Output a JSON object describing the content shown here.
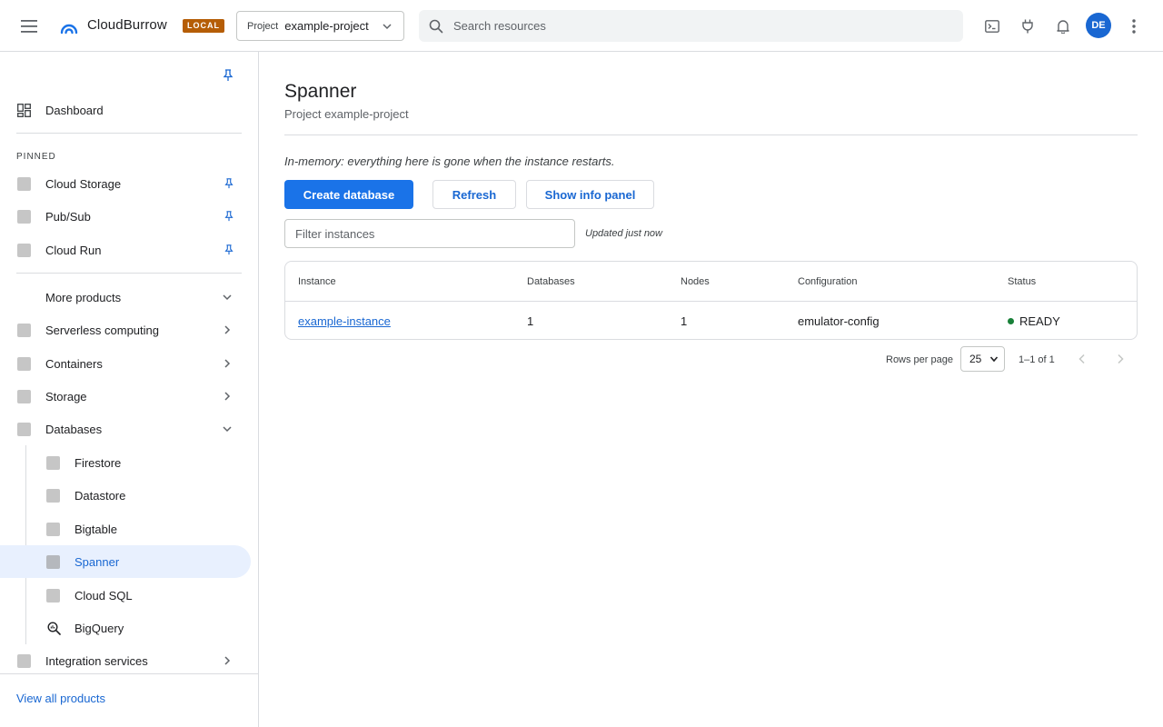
{
  "header": {
    "brand": "CloudBurrow",
    "env_badge": "LOCAL",
    "project_label": "Project",
    "project_value": "example-project",
    "search_placeholder": "Search resources",
    "avatar_initials": "DE",
    "icons": [
      "menu-icon",
      "cloud-logo-icon",
      "chevron-down-icon",
      "search-icon",
      "terminal-icon",
      "plug-icon",
      "bell-icon",
      "more-vert-icon"
    ]
  },
  "sidebar": {
    "dashboard": "Dashboard",
    "pinned_heading": "PINNED",
    "pinned": [
      {
        "label": "Cloud Storage"
      },
      {
        "label": "Pub/Sub"
      },
      {
        "label": "Cloud Run"
      }
    ],
    "more_products": "More products",
    "categories": [
      {
        "label": "Serverless computing"
      },
      {
        "label": "Containers"
      },
      {
        "label": "Storage"
      },
      {
        "label": "Databases"
      }
    ],
    "databases": [
      {
        "label": "Firestore"
      },
      {
        "label": "Datastore"
      },
      {
        "label": "Bigtable"
      },
      {
        "label": "Spanner"
      },
      {
        "label": "Cloud SQL"
      },
      {
        "label": "BigQuery"
      }
    ],
    "integration": "Integration services",
    "view_all": "View all products",
    "active_item": "Spanner"
  },
  "main": {
    "title": "Spanner",
    "subtitle": "Project example-project",
    "notice": "In-memory: everything here is gone when the instance restarts.",
    "buttons": {
      "create": "Create database",
      "refresh": "Refresh",
      "info_panel": "Show info panel"
    },
    "filter_placeholder": "Filter instances",
    "updated": "Updated just now",
    "table": {
      "columns": [
        "Instance",
        "Databases",
        "Nodes",
        "Configuration",
        "Status"
      ],
      "rows": [
        {
          "instance": "example-instance",
          "databases": "1",
          "nodes": "1",
          "configuration": "emulator-config",
          "status": "READY"
        }
      ]
    },
    "pagination": {
      "rows_per_page_label": "Rows per page",
      "rows_per_page_value": "25",
      "range": "1–1 of 1"
    }
  },
  "colors": {
    "accent": "#1a73e8",
    "link": "#1967d2",
    "badge": "#b55d06",
    "status_ready": "#188038",
    "active_bg": "#e8f0fe"
  }
}
